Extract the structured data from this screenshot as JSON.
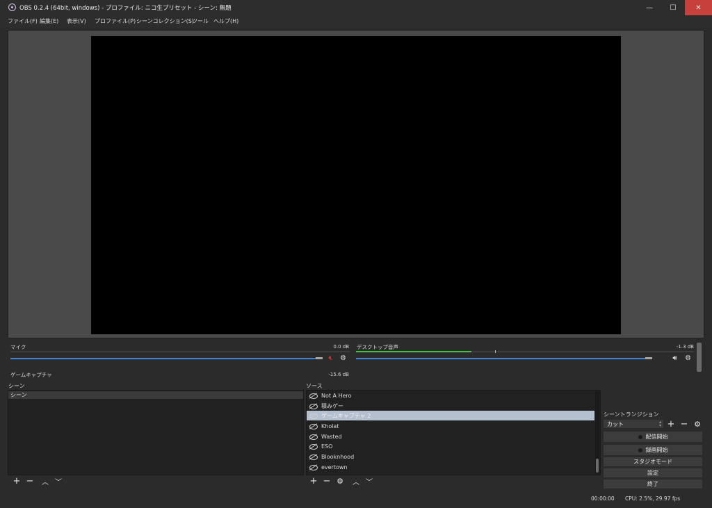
{
  "window": {
    "title": "OBS 0.2.4 (64bit, windows) - プロファイル: ニコ生プリセット - シーン: 無題",
    "minimize": "—",
    "maximize": "☐",
    "close": "✕"
  },
  "menu": [
    "ファイル(F)",
    "編集(E)",
    "表示(V)",
    "プロファイル(P)",
    "シーンコレクション(S)",
    "ツール",
    "ヘルプ(H)"
  ],
  "mixer": {
    "mic": {
      "label": "マイク",
      "db": "0.0 dB",
      "muted": true
    },
    "desktop": {
      "label": "デスクトップ音声",
      "db": "-1.3 dB",
      "muted": false
    },
    "game": {
      "label": "ゲームキャプチャ",
      "db": "-15.6 dB"
    }
  },
  "scenes": {
    "title": "シーン",
    "header": "シーン"
  },
  "sources": {
    "title": "ソース",
    "items": [
      "Not A Hero",
      "積みゲー",
      "ゲームキャプチャ 2",
      "Kholat",
      "Wasted",
      "ESO",
      "Blooknhood",
      "evertown"
    ],
    "selected_index": 2
  },
  "transition": {
    "title": "シーントランジション",
    "selected": "カット"
  },
  "controls": {
    "stream": "配信開始",
    "record": "録画開始",
    "studio": "スタジオモード",
    "settings": "設定",
    "exit": "終了"
  },
  "status": {
    "time": "00:00:00",
    "cpu": "CPU: 2.5%, 29.97 fps"
  },
  "colors": {
    "selected_row": "#b4bfd0",
    "meter": "#3ec33e",
    "volume_track": "#3c84d8",
    "mute": "#e03030",
    "close": "#c8403c"
  }
}
